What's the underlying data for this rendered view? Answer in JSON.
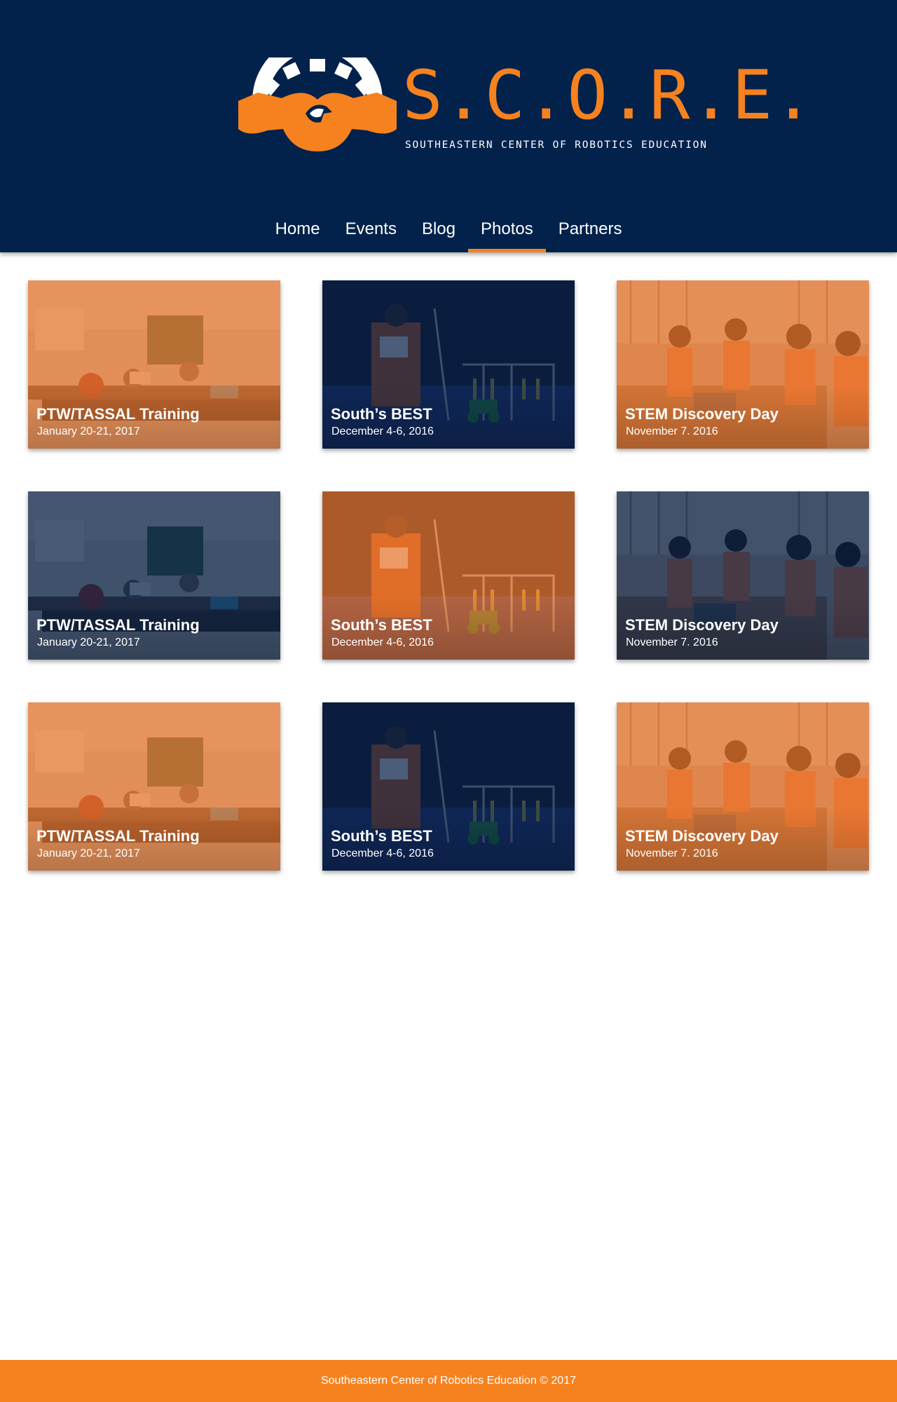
{
  "brand": {
    "wordmark": "S.C.O.R.E.",
    "tagline": "SOUTHEASTERN CENTER OF ROBOTICS EDUCATION",
    "colors": {
      "navy": "#02224b",
      "orange": "#f5821f",
      "white": "#ffffff"
    }
  },
  "nav": {
    "items": [
      {
        "label": "Home",
        "active": false
      },
      {
        "label": "Events",
        "active": false
      },
      {
        "label": "Blog",
        "active": false
      },
      {
        "label": "Photos",
        "active": true
      },
      {
        "label": "Partners",
        "active": false
      }
    ]
  },
  "gallery": {
    "cards": [
      {
        "title": "PTW/TASSAL Training",
        "date": "January 20-21, 2017",
        "tint": "orange",
        "scene": "classroom"
      },
      {
        "title": "South’s BEST",
        "date": "December 4-6, 2016",
        "tint": "navy",
        "scene": "arena"
      },
      {
        "title": "STEM Discovery Day",
        "date": "November 7. 2016",
        "tint": "orange",
        "scene": "students"
      },
      {
        "title": "PTW/TASSAL Training",
        "date": "January 20-21, 2017",
        "tint": "navy",
        "scene": "classroom"
      },
      {
        "title": "South’s BEST",
        "date": "December 4-6, 2016",
        "tint": "orange",
        "scene": "arena"
      },
      {
        "title": "STEM Discovery Day",
        "date": "November 7. 2016",
        "tint": "navy",
        "scene": "students"
      },
      {
        "title": "PTW/TASSAL Training",
        "date": "January 20-21, 2017",
        "tint": "orange",
        "scene": "classroom"
      },
      {
        "title": "South’s BEST",
        "date": "December 4-6, 2016",
        "tint": "navy",
        "scene": "arena"
      },
      {
        "title": "STEM Discovery Day",
        "date": "November 7. 2016",
        "tint": "orange",
        "scene": "students"
      }
    ]
  },
  "footer": {
    "text": "Southeastern Center of Robotics Education © 2017"
  }
}
